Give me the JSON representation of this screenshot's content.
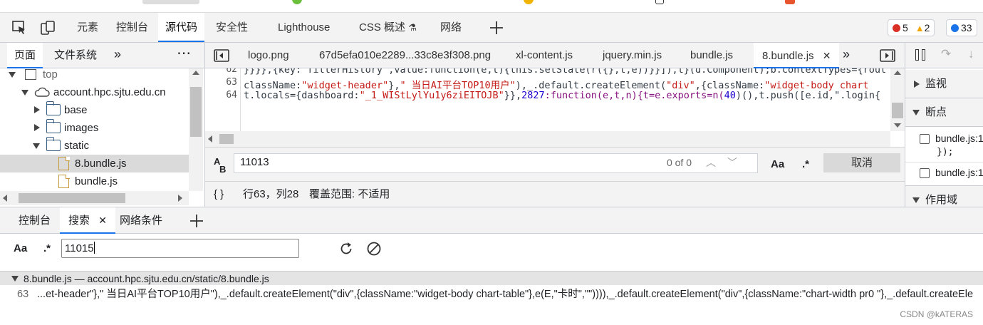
{
  "main_tabs": {
    "elements": "元素",
    "console": "控制台",
    "sources": "源代码",
    "security": "安全性",
    "lighthouse": "Lighthouse",
    "css_overview": "CSS 概述",
    "network": "网络"
  },
  "badges": {
    "errors": "5",
    "warnings": "2",
    "issues": "33"
  },
  "navigator": {
    "tab_page": "页面",
    "tab_filesystem": "文件系统",
    "tree": {
      "top": "top",
      "domain": "account.hpc.sjtu.edu.cn",
      "base": "base",
      "images": "images",
      "static": "static",
      "file_8bundle": "8.bundle.js",
      "file_bundle": "bundle.js"
    }
  },
  "editor_tabs": [
    "logo.png",
    "67d5efa010e2289...33c8e3f308.png",
    "xl-content.js",
    "jquery.min.js",
    "bundle.js",
    "8.bundle.js"
  ],
  "code": {
    "line_numbers": [
      "62",
      "63",
      "64"
    ],
    "line62": "}}}},{key:\"filterHistory\",value:function(e,t){this.setState(r({},t,e))}}]),t}(d.Component);b.contextTypes={rout",
    "line63_a": "className:",
    "line63_b": "\"widget-header\"",
    "line63_c": "},",
    "line63_d": "\" 当日AI平台TOP10用户\"",
    "line63_e": "),_.default.createElement(",
    "line63_f": "\"div\"",
    "line63_g": ",{className:",
    "line63_h": "\"widget-body chart",
    "line64_a": "t.locals={dashboard:",
    "line64_b": "\"_1_WIStLylYu1y6ziEITOJB\"",
    "line64_c": "}},",
    "line64_d": "2827",
    "line64_e": ":function(e,t,n){t=e.exports=n(",
    "line64_f": "40",
    "line64_g": ")(),t.push([e.id,\".login{"
  },
  "find": {
    "query": "11013",
    "count": "0 of 0",
    "match_case": "Aa",
    "regex": ".*",
    "cancel": "取消"
  },
  "status": {
    "braces": "{ }",
    "position": "行63，列28",
    "coverage": "覆盖范围: 不适用"
  },
  "debugger": {
    "watch": "监视",
    "breakpoints": "断点",
    "bp1_file": "bundle.js:1",
    "bp1_code": "});",
    "bp2_file": "bundle.js:1",
    "scope": "作用域"
  },
  "drawer": {
    "tab_console": "控制台",
    "tab_search": "搜索",
    "tab_network_conditions": "网络条件",
    "match_case": "Aa",
    "regex": ".*",
    "search_value": "11015"
  },
  "results": {
    "header": "8.bundle.js — account.hpc.sjtu.edu.cn/static/8.bundle.js",
    "line_number": "63",
    "line_text": "...et-header\"},\" 当日AI平台TOP10用户\"),_.default.createElement(\"div\",{className:\"widget-body chart-table\"},e(E,\"卡时\",\"\")))),_.default.createElement(\"div\",{className:\"chart-width pr0 \"},_.default.createEle"
  },
  "watermark": "CSDN @kATERAS",
  "colors": {
    "accent": "#1a73e8",
    "error": "#d93025",
    "warning": "#f2a600",
    "info": "#1a73e8"
  }
}
